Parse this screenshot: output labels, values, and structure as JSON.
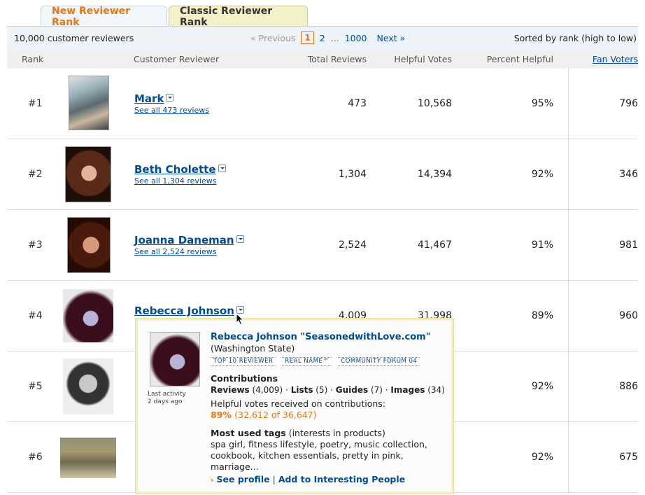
{
  "tabs": [
    {
      "label": "New Reviewer Rank",
      "active": true
    },
    {
      "label": "Classic Reviewer Rank",
      "active": false
    }
  ],
  "info": {
    "count": "10,000 customer reviewers",
    "pager": {
      "prev": "« Previous",
      "current": "1",
      "page2": "2",
      "dots": "...",
      "last": "1000",
      "next": "Next »"
    },
    "sorted": "Sorted by rank (high to low)"
  },
  "columns": {
    "rank": "Rank",
    "reviewer": "Customer Reviewer",
    "total": "Total Reviews",
    "helpful": "Helpful Votes",
    "percent": "Percent Helpful",
    "fan": "Fan Voters"
  },
  "rows": [
    {
      "rank": "#1",
      "name": "Mark",
      "see": "See all 473 reviews",
      "total": "473",
      "helpful": "10,568",
      "percent": "95%",
      "fan": "796"
    },
    {
      "rank": "#2",
      "name": "Beth Cholette",
      "see": "See all 1,304 reviews",
      "total": "1,304",
      "helpful": "14,394",
      "percent": "92%",
      "fan": "346"
    },
    {
      "rank": "#3",
      "name": "Joanna Daneman",
      "see": "See all 2,524 reviews",
      "total": "2,524",
      "helpful": "41,467",
      "percent": "91%",
      "fan": "981"
    },
    {
      "rank": "#4",
      "name": "Rebecca Johnson",
      "see": "",
      "total": "4,009",
      "helpful": "31,998",
      "percent": "89%",
      "fan": "960"
    },
    {
      "rank": "#5",
      "name": "",
      "see": "",
      "total": "",
      "helpful": "",
      "percent": "92%",
      "fan": "886"
    },
    {
      "rank": "#6",
      "name": "",
      "see": "",
      "total": "",
      "helpful": "",
      "percent": "92%",
      "fan": "675"
    }
  ],
  "popup": {
    "name": "Rebecca Johnson \"SeasonedwithLove.com\"",
    "location": "(Washington State)",
    "badges": [
      "TOP 10 REVIEWER",
      "REAL NAME™",
      "COMMUNITY FORUM 04"
    ],
    "activity_label": "Last activity",
    "activity_value": "2 days ago",
    "contributions_title": "Contributions",
    "reviews_label": "Reviews",
    "reviews_count": "(4,009)",
    "lists_label": "Lists",
    "lists_count": "(5)",
    "guides_label": "Guides",
    "guides_count": "(7)",
    "images_label": "Images",
    "images_count": "(34)",
    "helpful_text": "Helpful votes received on contributions:",
    "helpful_pct": "89%",
    "helpful_detail": "(32,612 of 36,647)",
    "tags_title": "Most used tags",
    "tags_sub": "(interests in products)",
    "tags_list": "spa girl, fitness lifestyle, poetry, music collection, cookbook, kitchen essentials, pretty in pink, marriage...",
    "see_profile": "See profile",
    "add_interesting": "Add to Interesting People"
  },
  "icons": {
    "dropdown": "chevron-down-icon",
    "cursor": "pointer-cursor-icon"
  },
  "colors": {
    "link": "#004b91",
    "accent": "#e47911",
    "tab_inactive": "#f4f1c9",
    "bar": "#eef3f8"
  }
}
